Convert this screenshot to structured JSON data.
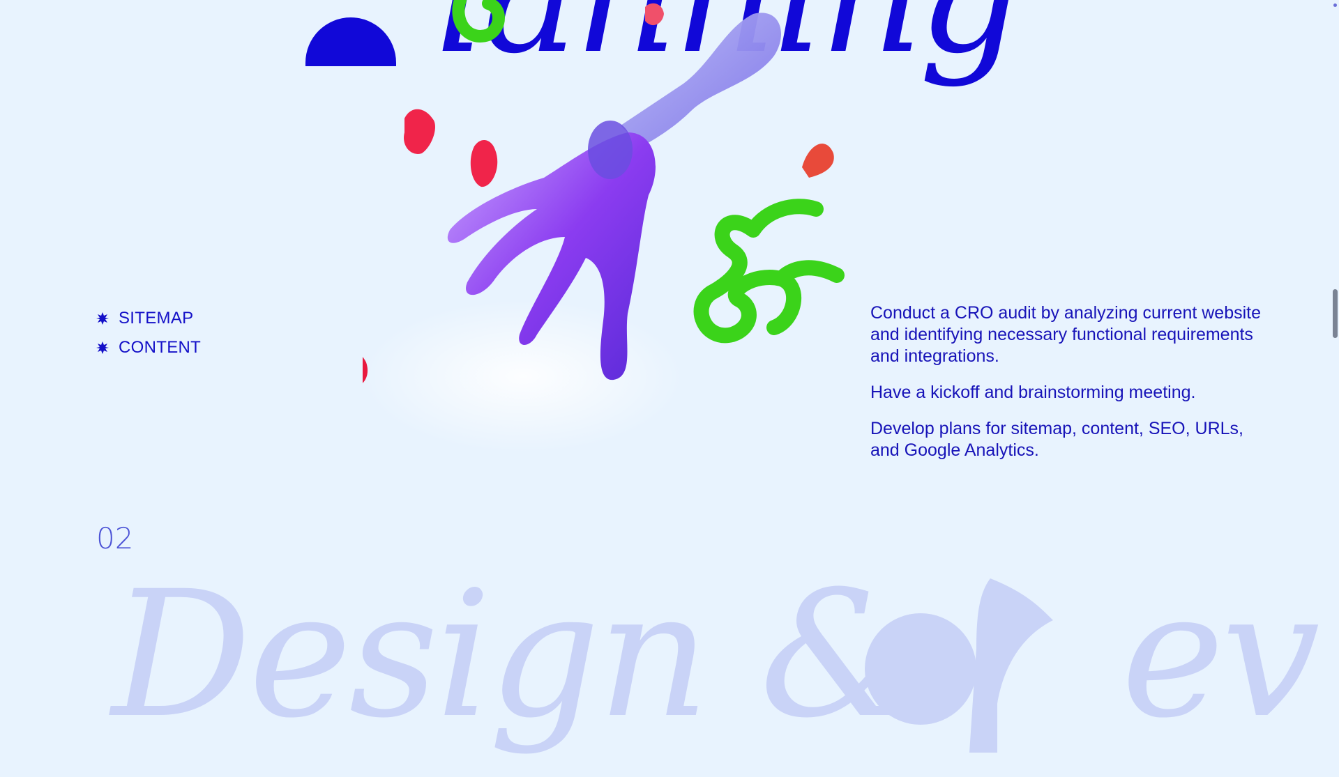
{
  "colors": {
    "background": "#e8f3fe",
    "accent_blue": "#1108d8",
    "text_blue": "#1713b8",
    "faded_heading": "#c9d3f7",
    "green_vine": "#3bd31a",
    "red_petal": "#f0244a",
    "purple_rake": "#8b3cf0"
  },
  "section1": {
    "heading": "Planning",
    "heading_visible": "lanning",
    "bullets": [
      "SITEMAP",
      "CONTENT"
    ],
    "bullet_icon": "star-bullet-icon",
    "description": [
      "Conduct a CRO audit by analyzing current website and identifying necessary functional requirements and integrations.",
      "Have a kickoff and brainstorming meeting.",
      "Develop plans for sitemap, content, SEO, URLs, and Google Analytics."
    ]
  },
  "section2": {
    "number": "02",
    "heading": "Design &dev",
    "heading_start": "Design &",
    "heading_end": "ev"
  }
}
